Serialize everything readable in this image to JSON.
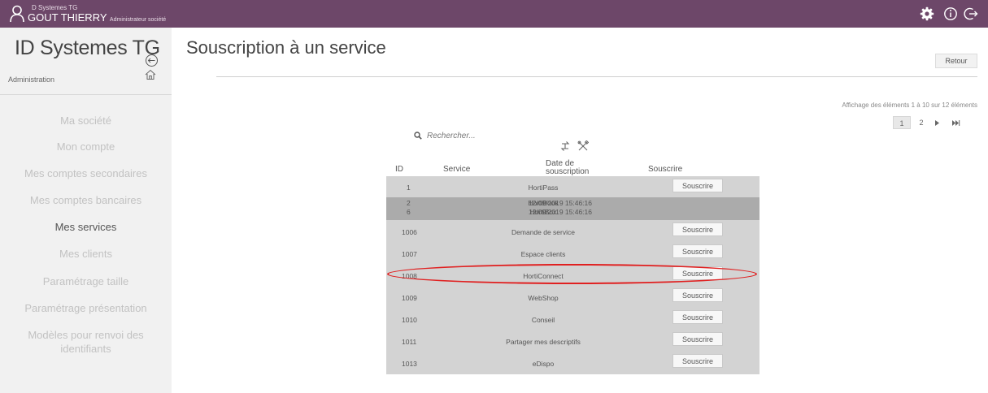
{
  "header": {
    "company": "D Systemes TG",
    "user_name": "GOUT THIERRY",
    "user_role": "Administrateur société",
    "icons": [
      "gear-icon",
      "info-icon",
      "logout-icon"
    ],
    "bar_color": "#6d4769"
  },
  "sidebar": {
    "brand": "ID Systemes TG",
    "section": "Administration",
    "items": [
      {
        "label": "Ma société",
        "active": false
      },
      {
        "label": "Mon compte",
        "active": false
      },
      {
        "label": "Mes comptes secondaires",
        "active": false
      },
      {
        "label": "Mes comptes bancaires",
        "active": false
      },
      {
        "label": "Mes services",
        "active": true
      },
      {
        "label": "Mes clients",
        "active": false
      },
      {
        "label": "Paramétrage taille",
        "active": false
      },
      {
        "label": "Paramétrage présentation",
        "active": false
      },
      {
        "label": "Modèles pour renvoi des identifiants",
        "active": false
      }
    ]
  },
  "main": {
    "title": "Souscription à un service",
    "back_label": "Retour",
    "pagination": {
      "info": "Affichage des éléments 1 à 10 sur 12 éléments",
      "current": "1",
      "next_page": "2"
    },
    "search": {
      "placeholder": "Rechercher..."
    },
    "table": {
      "headers": {
        "id": "ID",
        "service": "Service",
        "date": "Date de souscription",
        "subscribe": "Souscrire"
      },
      "subscribe_label": "Souscrire",
      "subscribed_rows": [
        {
          "id": "2",
          "service": "HortiBook",
          "date": "12/09/2019 15:46:16"
        },
        {
          "id": "6",
          "service": "HortiBox",
          "date": "12/09/2019 15:46:16"
        }
      ],
      "rows": [
        {
          "id": "1",
          "service": "HortiPass"
        },
        {
          "id": "1006",
          "service": "Demande de service"
        },
        {
          "id": "1007",
          "service": "Espace clients"
        },
        {
          "id": "1008",
          "service": "HortiConnect",
          "highlighted": true
        },
        {
          "id": "1009",
          "service": "WebShop"
        },
        {
          "id": "1010",
          "service": "Conseil"
        },
        {
          "id": "1011",
          "service": "Partager mes descriptifs"
        },
        {
          "id": "1013",
          "service": "eDispo"
        }
      ]
    }
  }
}
